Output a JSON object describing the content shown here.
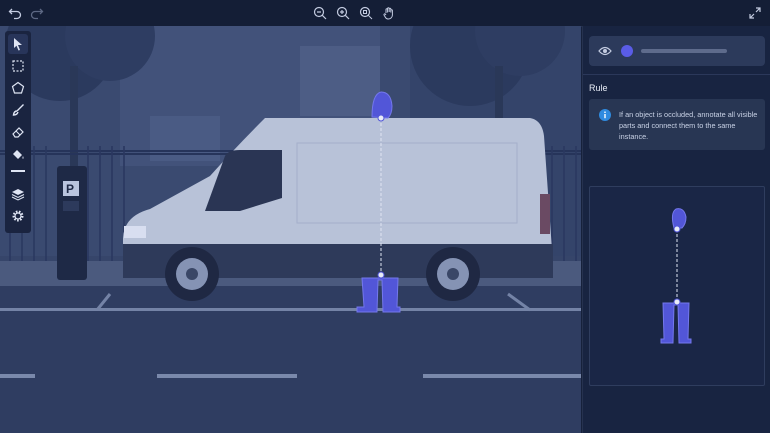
{
  "toolbar": {
    "undo_icon": "undo-icon",
    "redo_icon": "redo-icon",
    "zoom_out_icon": "zoom-out-icon",
    "zoom_in_icon": "zoom-in-icon",
    "zoom_fit_icon": "zoom-fit-icon",
    "pan_icon": "hand-icon",
    "fullscreen_icon": "expand-icon"
  },
  "tools": [
    "pointer",
    "rectangle",
    "polygon",
    "brush",
    "eraser",
    "fill",
    "layers",
    "settings"
  ],
  "layer": {
    "color": "#5a5ce6"
  },
  "rule": {
    "title": "Rule",
    "text": "If an object is occluded, annotate all visible parts and connect them to the same instance."
  },
  "colors": {
    "annotation": "#5256d8",
    "overlay": "#1e2d54",
    "panel": "#182441"
  }
}
